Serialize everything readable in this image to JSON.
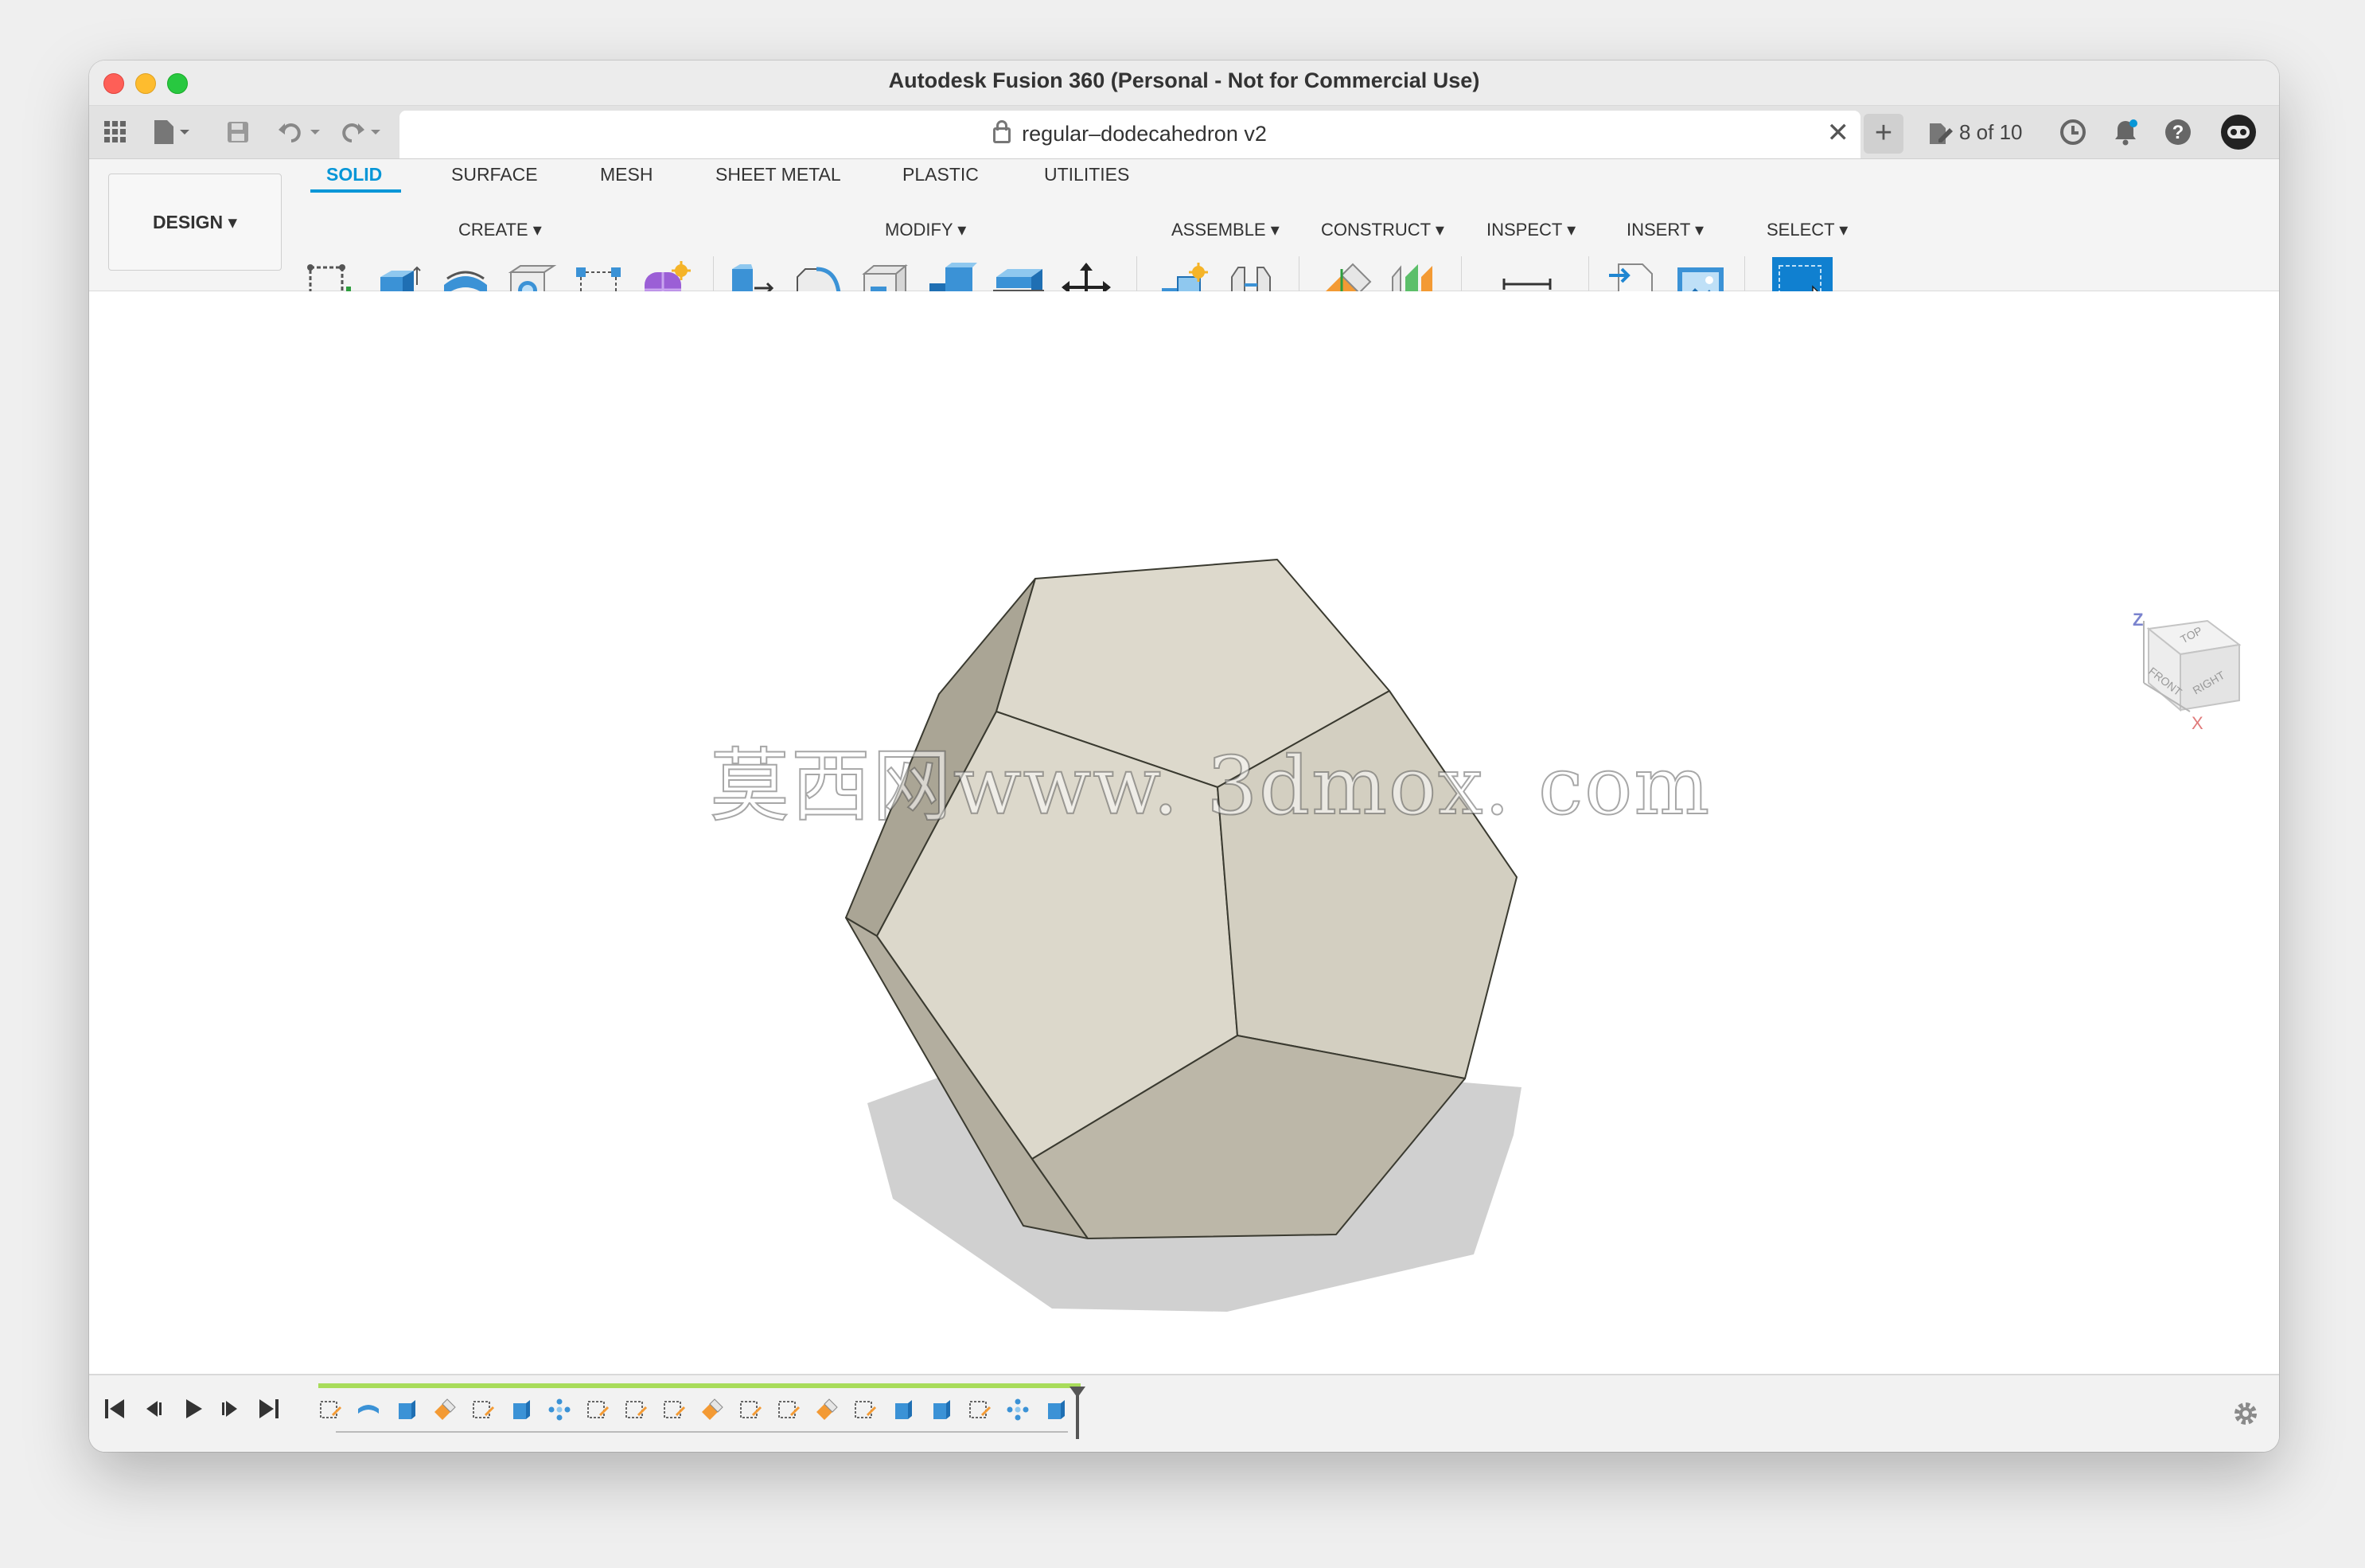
{
  "window": {
    "title": "Autodesk Fusion 360 (Personal - Not for Commercial Use)"
  },
  "tabbar": {
    "document_tab": "regular–dodecahedron v2",
    "close_glyph": "✕",
    "new_tab_glyph": "+",
    "versions": "8 of 10"
  },
  "ribbon": {
    "workspace": "DESIGN ▾",
    "tabs": [
      "SOLID",
      "SURFACE",
      "MESH",
      "SHEET METAL",
      "PLASTIC",
      "UTILITIES"
    ],
    "active_tab": "SOLID",
    "groups": {
      "create": "CREATE ▾",
      "modify": "MODIFY ▾",
      "assemble": "ASSEMBLE ▾",
      "construct": "CONSTRUCT ▾",
      "inspect": "INSPECT ▾",
      "insert": "INSERT ▾",
      "select": "SELECT ▾"
    },
    "icons": {
      "create": [
        "create-sketch-icon",
        "extrude-icon",
        "revolve-icon",
        "hole-icon",
        "pattern-icon",
        "form-icon"
      ],
      "modify": [
        "press-pull-icon",
        "fillet-icon",
        "shell-icon",
        "combine-icon",
        "split-face-icon",
        "move-icon"
      ],
      "assemble": [
        "new-component-icon",
        "joint-icon"
      ],
      "construct": [
        "offset-plane-icon",
        "midplane-icon"
      ],
      "inspect": [
        "measure-icon"
      ],
      "insert": [
        "insert-svg-icon",
        "insert-canvas-icon"
      ],
      "select": [
        "select-icon"
      ]
    }
  },
  "viewport": {
    "watermark": "莫西网www. 3dmox. com",
    "viewcube": {
      "top": "TOP",
      "front": "FRONT",
      "right": "RIGHT",
      "axis_z": "Z",
      "axis_x": "X"
    }
  },
  "timeline": {
    "features": [
      "sketch",
      "revolve",
      "extrude",
      "plane",
      "sketch",
      "extrude",
      "pattern",
      "sketch",
      "sketch",
      "sketch",
      "plane",
      "sketch",
      "sketch",
      "plane",
      "sketch",
      "extrude",
      "extrude",
      "sketch",
      "pattern",
      "extrude"
    ]
  },
  "colors": {
    "accent": "#0696d7",
    "face_light": "#ddd9cc",
    "face_mid": "#d2cdbf",
    "face_dark": "#bdb8a8",
    "timeline_progress": "#a8dc5a"
  }
}
